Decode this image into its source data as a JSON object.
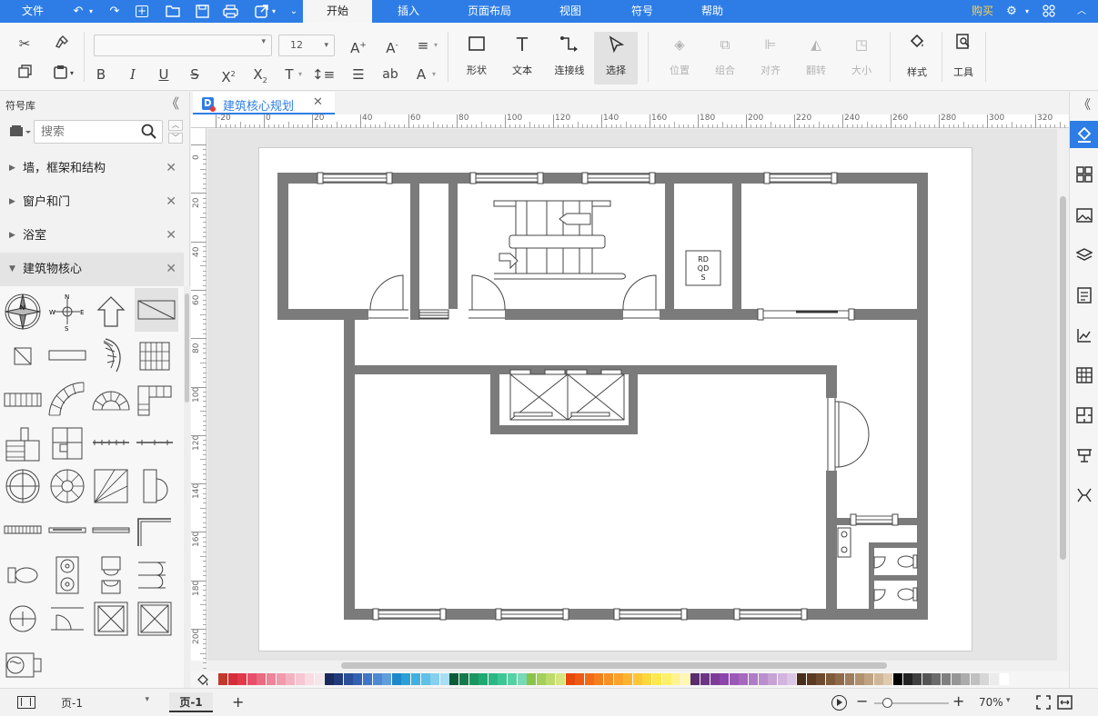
{
  "menubar": {
    "file": "文件",
    "tabs": [
      "开始",
      "插入",
      "页面布局",
      "视图",
      "符号",
      "帮助"
    ],
    "buy": "购买"
  },
  "ribbon": {
    "font_size": "12",
    "tools": {
      "shape": "形状",
      "text": "文本",
      "connector": "连接线",
      "select": "选择",
      "position": "位置",
      "group": "组合",
      "align": "对齐",
      "flip": "翻转",
      "size": "大小",
      "style": "样式",
      "tools": "工具"
    }
  },
  "sidebar": {
    "title": "符号库",
    "search_placeholder": "搜索",
    "categories": [
      {
        "label": "墙，框架和结构",
        "open": false
      },
      {
        "label": "窗户和门",
        "open": false
      },
      {
        "label": "浴室",
        "open": false
      },
      {
        "label": "建筑物核心",
        "open": true
      }
    ]
  },
  "document": {
    "tab_title": "建筑核心规划"
  },
  "rulers": {
    "h_labels": [
      "-20",
      "0",
      "20",
      "40",
      "60",
      "80",
      "100",
      "120",
      "140",
      "160",
      "180",
      "200",
      "220",
      "240",
      "260",
      "280",
      "300",
      "320"
    ],
    "v_labels": [
      "0",
      "20",
      "40",
      "60",
      "80",
      "100",
      "120",
      "140",
      "160",
      "180",
      "200"
    ]
  },
  "diagram": {
    "elevator_label": [
      "RD",
      "QD",
      "S"
    ]
  },
  "palette": {
    "colors": [
      "#c0392b",
      "#d62d3a",
      "#e0394a",
      "#e8506a",
      "#ea6a80",
      "#ee8399",
      "#f19aac",
      "#f4b2c0",
      "#f6c7d2",
      "#f9dce3",
      "#f5e6ea",
      "#1b2a5c",
      "#223b7a",
      "#2b4f98",
      "#3462b3",
      "#3f76c6",
      "#4e8ad1",
      "#5f9edc",
      "#1e88c8",
      "#29a0d8",
      "#40b0e0",
      "#60c0e8",
      "#85d0ee",
      "#a9dff4",
      "#0d5c3a",
      "#137a4c",
      "#1a9660",
      "#20a873",
      "#2bb885",
      "#3ec796",
      "#55d1a6",
      "#78d9b6",
      "#8bc34a",
      "#a4cf5a",
      "#bddb6c",
      "#d6e67e",
      "#e9480c",
      "#ee5a12",
      "#f26c18",
      "#f57e1e",
      "#f89024",
      "#faa22a",
      "#fcb430",
      "#fdc636",
      "#fed83c",
      "#ffe84a",
      "#fff06a",
      "#fff490",
      "#fff8b5",
      "#5b2c6f",
      "#6c3483",
      "#7d3c98",
      "#8e44ad",
      "#9b59b6",
      "#a569bd",
      "#b07cc6",
      "#bb8fce",
      "#c6a2d6",
      "#d2b4de",
      "#dcc6e6",
      "#4a2c1a",
      "#5d3a22",
      "#6e4a2e",
      "#7f5a3a",
      "#906b4a",
      "#a07d5c",
      "#b0906f",
      "#c0a383",
      "#d0b698",
      "#e0caae",
      "#000000",
      "#222222",
      "#404040",
      "#555555",
      "#6b6b6b",
      "#808080",
      "#969696",
      "#ababab",
      "#c0c0c0",
      "#d6d6d6",
      "#ebebeb",
      "#ffffff"
    ]
  },
  "status": {
    "page_select": "页-1",
    "page_tab": "页-1",
    "zoom": "70%"
  }
}
